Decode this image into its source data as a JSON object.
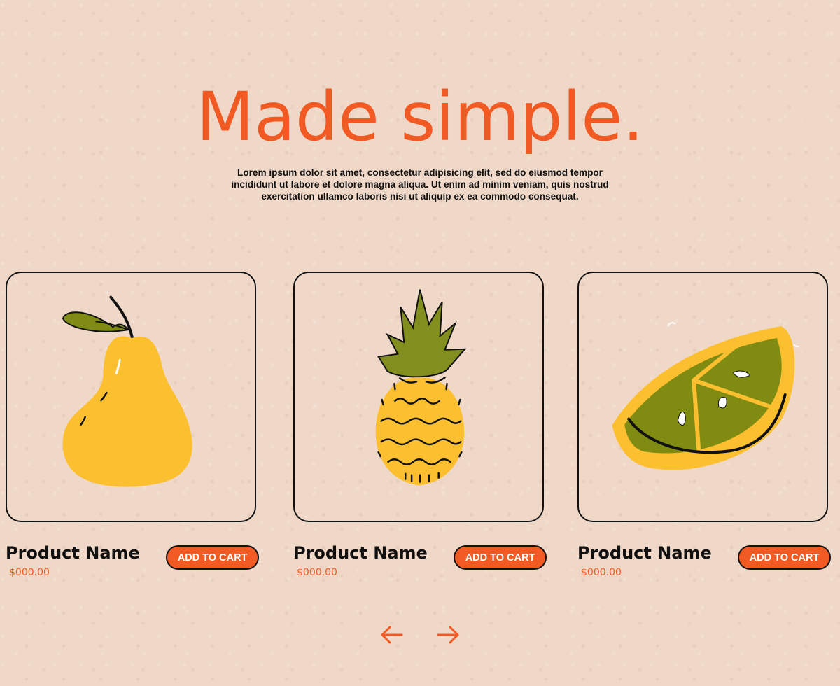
{
  "hero": {
    "title": "Made simple.",
    "description": "Lorem ipsum dolor sit amet, consectetur adipisicing elit, sed do eiusmod tempor incididunt ut labore et dolore magna aliqua. Ut enim ad minim veniam, quis nostrud exercitation ullamco laboris nisi ut aliquip ex ea commodo consequat."
  },
  "products": [
    {
      "name": "Product Name",
      "price": "$000.00",
      "cta_label": "ADD TO CART",
      "image_icon": "pear-icon"
    },
    {
      "name": "Product Name",
      "price": "$000.00",
      "cta_label": "ADD TO CART",
      "image_icon": "pineapple-icon"
    },
    {
      "name": "Product Name",
      "price": "$000.00",
      "cta_label": "ADD TO CART",
      "image_icon": "orange-slice-icon"
    }
  ],
  "navigation": {
    "previous_icon": "arrow-left-icon",
    "next_icon": "arrow-right-icon"
  },
  "colors": {
    "background": "#f0d8c8",
    "accent": "#f15a22",
    "text": "#111111",
    "fruit_yellow": "#fcbf2f",
    "leaf_green": "#7c8514"
  }
}
